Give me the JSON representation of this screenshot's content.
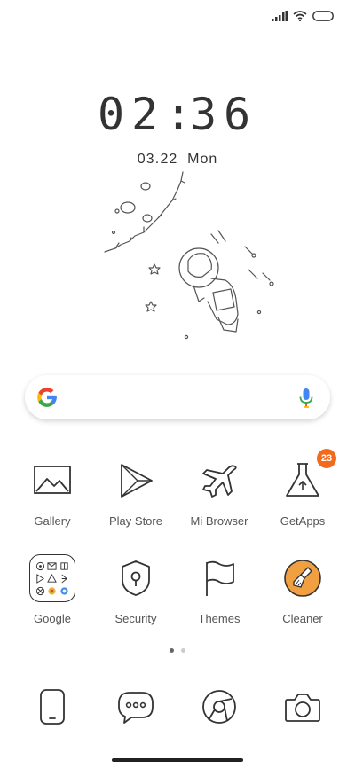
{
  "status_bar": {
    "icons": [
      "signal-icon",
      "wifi-icon",
      "battery-icon"
    ]
  },
  "lockscreen": {
    "time_digits": [
      "0",
      "2",
      ":",
      "3",
      "6"
    ],
    "date_month": "03",
    "date_day": "22",
    "date_weekday": "Mon"
  },
  "search_bar": {
    "logo": "google-g-icon",
    "mic": "mic-icon",
    "colors": {
      "blue": "#4285F4",
      "red": "#EA4335",
      "yellow": "#FBBC05",
      "green": "#34A853"
    }
  },
  "apps_row1": [
    {
      "label": "Gallery",
      "icon": "gallery-icon"
    },
    {
      "label": "Play Store",
      "icon": "play-store-icon"
    },
    {
      "label": "Mi Browser",
      "icon": "airplane-icon"
    },
    {
      "label": "GetApps",
      "icon": "flask-icon",
      "badge": "23"
    }
  ],
  "apps_row2": [
    {
      "label": "Google",
      "icon": "google-folder-icon"
    },
    {
      "label": "Security",
      "icon": "shield-icon"
    },
    {
      "label": "Themes",
      "icon": "flag-icon"
    },
    {
      "label": "Cleaner",
      "icon": "brush-icon"
    }
  ],
  "pages": {
    "count": 2,
    "active": 1
  },
  "dock": [
    {
      "icon": "phone-icon"
    },
    {
      "icon": "messages-icon"
    },
    {
      "icon": "browser-icon"
    },
    {
      "icon": "camera-icon"
    }
  ],
  "accent": "#f26a1b",
  "cleaner_color": "#f0a040"
}
